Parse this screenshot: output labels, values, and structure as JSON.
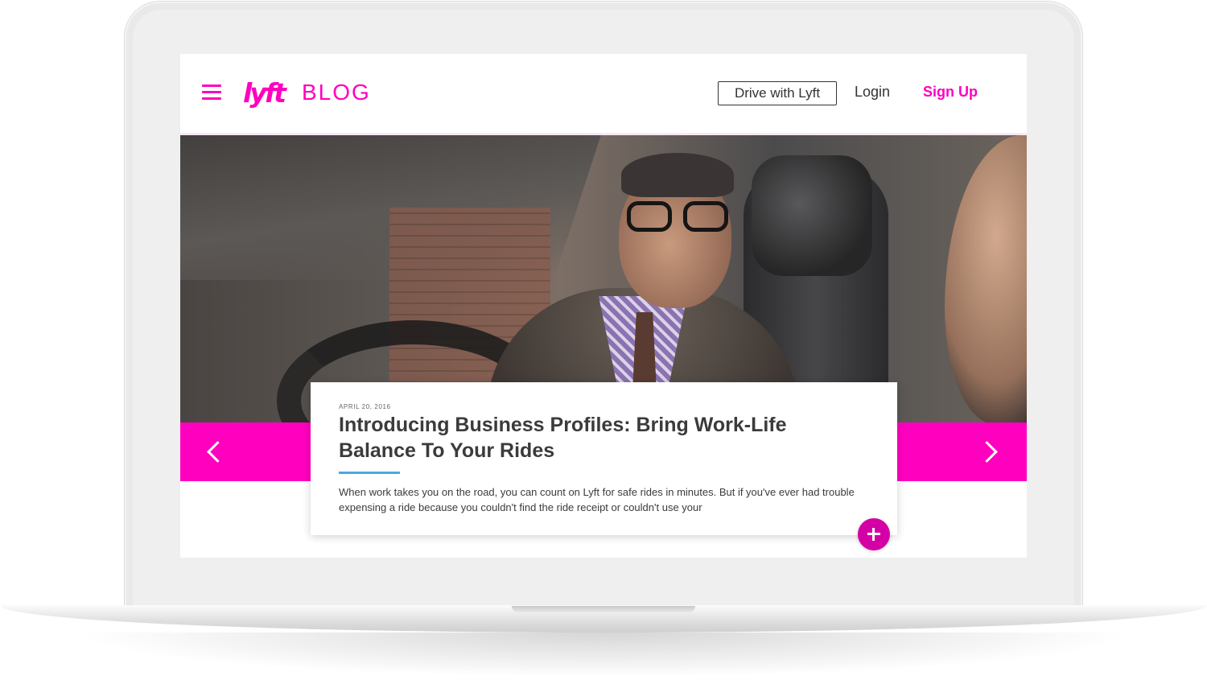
{
  "header": {
    "logo_text": "lyft",
    "blog_label": "BLOG",
    "drive_button": "Drive with Lyft",
    "login_link": "Login",
    "signup_link": "Sign Up"
  },
  "article": {
    "date": "APRIL 20, 2016",
    "title": "Introducing Business Profiles: Bring Work-Life Balance To Your Rides",
    "excerpt": "When work takes you on the road, you can count on Lyft for safe rides in minutes. But if you've ever had trouble expensing a ride because you couldn't find the ride receipt or couldn't use your"
  },
  "icons": {
    "menu": "hamburger-menu-icon",
    "prev": "chevron-left-icon",
    "next": "chevron-right-icon",
    "expand": "plus-icon"
  },
  "colors": {
    "brand": "#ff00bf",
    "expand_button": "#d400a5",
    "accent_rule": "#4aa7e4",
    "text": "#3b3b3b"
  }
}
